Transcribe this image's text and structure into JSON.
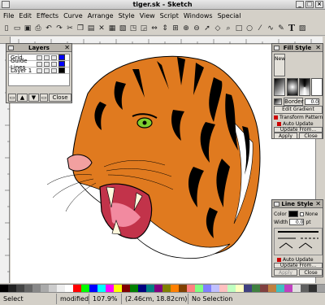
{
  "window": {
    "title": "tiger.sk - Sketch"
  },
  "menu": [
    "File",
    "Edit",
    "Effects",
    "Curve",
    "Arrange",
    "Style",
    "View",
    "Script",
    "Windows",
    "Special"
  ],
  "toolbar": {
    "text_tool_label": "T"
  },
  "layers_panel": {
    "title": "Layers",
    "rows": [
      {
        "name": "Grid",
        "color": "#0000ff"
      },
      {
        "name": "Guide Lines",
        "color": "#0000ff"
      },
      {
        "name": "Layer 1",
        "color": "#000000"
      }
    ],
    "close_label": "Close"
  },
  "fill_panel": {
    "title": "Fill Style",
    "new_label": "New",
    "border_label": "Border",
    "border_value": "0.0",
    "edit_gradient_label": "Edit Gradient",
    "transform_pattern_label": "Transform Pattern",
    "auto_update_label": "Auto Update",
    "update_from_label": "Update From...",
    "apply_label": "Apply",
    "close_label": "Close"
  },
  "line_panel": {
    "title": "Line Style",
    "color_label": "Color",
    "none_label": "None",
    "width_label": "Width",
    "width_value": "0.0",
    "width_unit": "pt",
    "auto_update_label": "Auto Update",
    "update_from_label": "Update From...",
    "apply_label": "Apply",
    "close_label": "Close"
  },
  "status": {
    "mode": "Select",
    "modified": "modified",
    "zoom": "107.9%",
    "coords": "(2.46cm, 18.82cm)",
    "selection": "No Selection"
  },
  "colors": {
    "tiger_orange": "#e07a1f",
    "palette": [
      "#000000",
      "#222222",
      "#444444",
      "#666666",
      "#888888",
      "#aaaaaa",
      "#cccccc",
      "#eeeeee",
      "#ffffff",
      "#ff0000",
      "#00ff00",
      "#0000ff",
      "#00ffff",
      "#ff00ff",
      "#ffff00",
      "#800000",
      "#008000",
      "#000080",
      "#008080",
      "#800080",
      "#808000",
      "#ff8000",
      "#804000",
      "#ff8080",
      "#80ff80",
      "#8080ff",
      "#c0c0ff",
      "#ffc0c0",
      "#c0ffc0",
      "#ffffc0",
      "#404080",
      "#408040",
      "#804040",
      "#c08040",
      "#40c0c0",
      "#c040c0",
      "#e0e0e0",
      "#606060",
      "#303030",
      "#a0a0a0"
    ]
  }
}
